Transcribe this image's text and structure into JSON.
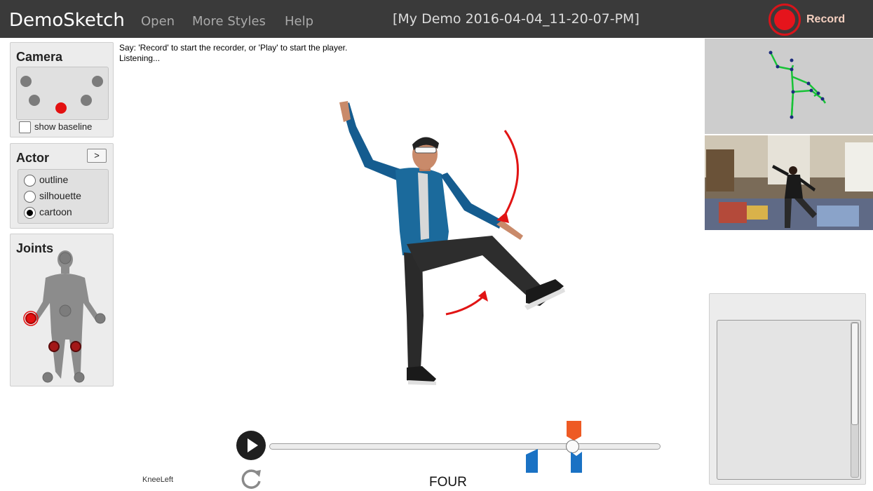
{
  "app": {
    "name": "DemoSketch",
    "menu": [
      "Open",
      "More Styles",
      "Help"
    ],
    "document_title": "[My Demo 2016-04-04_11-20-07-PM]",
    "record_label": "Record",
    "record_color": "#e5141c"
  },
  "camera": {
    "title": "Camera",
    "baseline_label": "show baseline",
    "baseline_checked": false,
    "active_preset_index": 4
  },
  "actor": {
    "title": "Actor",
    "expand_label": ">",
    "styles": [
      "outline",
      "silhouette",
      "cartoon"
    ],
    "selected": "cartoon"
  },
  "joints": {
    "title": "Joints",
    "highlighted": [
      "HandRight",
      "KneeLeft",
      "KneeRight"
    ]
  },
  "instructions": {
    "line1": "Say: 'Record' to start the recorder, or 'Play' to start the player.",
    "line2": "Listening..."
  },
  "player": {
    "selected_joint": "KneeLeft",
    "frame_word": "FOUR",
    "playhead_fraction": 0.776,
    "accent_orange": "#ee5a24",
    "accent_blue": "#1a72c4"
  }
}
